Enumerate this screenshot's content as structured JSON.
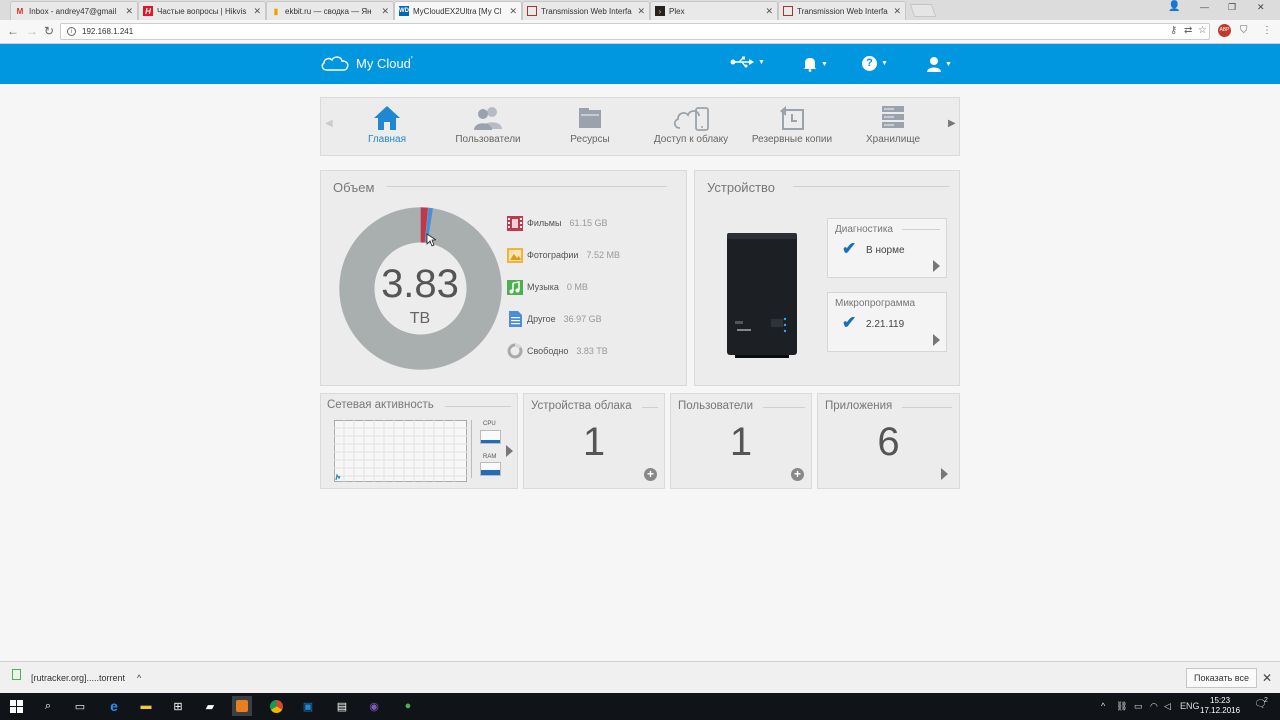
{
  "browser": {
    "tabs": [
      {
        "title": "Inbox - andrey47@gmail",
        "icon": "gmail-icon",
        "color": "#d93025"
      },
      {
        "title": "Частые вопросы | Hikvis",
        "icon": "hikvision-icon",
        "color": "#e0142b"
      },
      {
        "title": "ekbit.ru — сводка — Ян",
        "icon": "metrika-icon",
        "color": "#f0a000"
      },
      {
        "title": "MyCloudEX2Ultra [My Cl",
        "icon": "wd-icon",
        "color": "#0067b1"
      },
      {
        "title": "Transmission Web Interfa",
        "icon": "transmission-icon",
        "color": "#b03030"
      },
      {
        "title": "Plex",
        "icon": "plex-icon",
        "color": "#e5a00d"
      },
      {
        "title": "Transmission Web Interfa",
        "icon": "transmission-icon",
        "color": "#b03030"
      }
    ],
    "url": "192.168.1.241"
  },
  "app": {
    "name": "My Cloud",
    "trademark": "'",
    "accent": "#0096e0"
  },
  "nav": {
    "items": [
      {
        "label": "Главная",
        "icon": "home-icon"
      },
      {
        "label": "Пользователи",
        "icon": "users-icon"
      },
      {
        "label": "Ресурсы",
        "icon": "folder-icon"
      },
      {
        "label": "Доступ к облаку",
        "icon": "cloud-device-icon"
      },
      {
        "label": "Резервные копии",
        "icon": "backup-icon"
      },
      {
        "label": "Хранилище",
        "icon": "storage-icon"
      }
    ]
  },
  "capacity": {
    "title": "Объем",
    "value": "3.83",
    "unit": "TB",
    "legend": [
      {
        "label": "Фильмы",
        "value": "61.15 GB",
        "color": "#c0384b"
      },
      {
        "label": "Фотографии",
        "value": "7.52 MB",
        "color": "#f0b43c"
      },
      {
        "label": "Музыка",
        "value": "0 MB",
        "color": "#4caf50"
      },
      {
        "label": "Другое",
        "value": "36.97 GB",
        "color": "#4a8fd6"
      },
      {
        "label": "Свободно",
        "value": "3.83 TB",
        "color": "#a9a9a9"
      }
    ],
    "segments": [
      {
        "label": "Фильмы",
        "fraction": 0.0153,
        "color": "#c0384b"
      },
      {
        "label": "Фотографии",
        "fraction": 0.0005,
        "color": "#f0b43c"
      },
      {
        "label": "Музыка",
        "fraction": 0.0,
        "color": "#4caf50"
      },
      {
        "label": "Другое",
        "fraction": 0.0092,
        "color": "#4a8fd6"
      },
      {
        "label": "Свободно",
        "fraction": 0.975,
        "color": "#a9aeae"
      }
    ]
  },
  "device": {
    "title": "Устройство",
    "diagnostics": {
      "title": "Диагностика",
      "status": "В норме"
    },
    "firmware": {
      "title": "Микропрограмма",
      "version": "2.21.119"
    }
  },
  "network": {
    "title": "Сетевая активность",
    "cpu_label": "CPU",
    "ram_label": "RAM"
  },
  "cloud_devices": {
    "title": "Устройства облака",
    "count": "1"
  },
  "users": {
    "title": "Пользователи",
    "count": "1"
  },
  "apps": {
    "title": "Приложения",
    "count": "6"
  },
  "downloads": {
    "file": "[rutracker.org].....torrent",
    "show_all": "Показать все"
  },
  "taskbar": {
    "lang": "ENG",
    "time": "15:23",
    "date": "17.12.2016",
    "notifications": "2"
  }
}
